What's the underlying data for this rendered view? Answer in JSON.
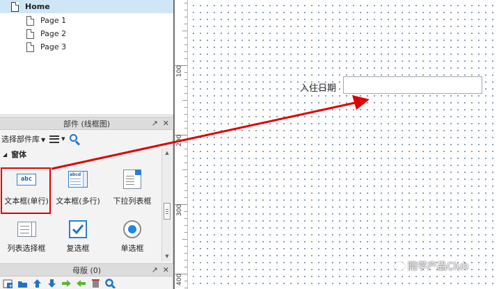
{
  "sitemap": {
    "pages": [
      {
        "label": "Home"
      },
      {
        "label": "Page 1"
      },
      {
        "label": "Page 2"
      },
      {
        "label": "Page 3"
      }
    ]
  },
  "widgets_panel": {
    "title": "部件 (线框图)",
    "library_label": "选择部件库",
    "group_label": "窗体",
    "items": [
      {
        "label": "文本框(单行)",
        "icon": "single-line-textbox-icon",
        "icon_text": "abc"
      },
      {
        "label": "文本框(多行)",
        "icon": "multi-line-textarea-icon",
        "icon_text": "abcd"
      },
      {
        "label": "下拉列表框",
        "icon": "droplist-icon"
      },
      {
        "label": "列表选择框",
        "icon": "listbox-icon"
      },
      {
        "label": "复选框",
        "icon": "checkbox-icon"
      },
      {
        "label": "单选框",
        "icon": "radio-button-icon"
      }
    ]
  },
  "masters_panel": {
    "title": "母版 (0)"
  },
  "canvas": {
    "ruler_numbers": [
      "100",
      "200",
      "300",
      "400"
    ],
    "field_label": "入住日期",
    "field_value": "",
    "watermark": "陪学产品Club"
  },
  "colors": {
    "selection_highlight": "#cfe6f7",
    "annotation_red": "#e00000",
    "accent_blue": "#1e74c7"
  }
}
